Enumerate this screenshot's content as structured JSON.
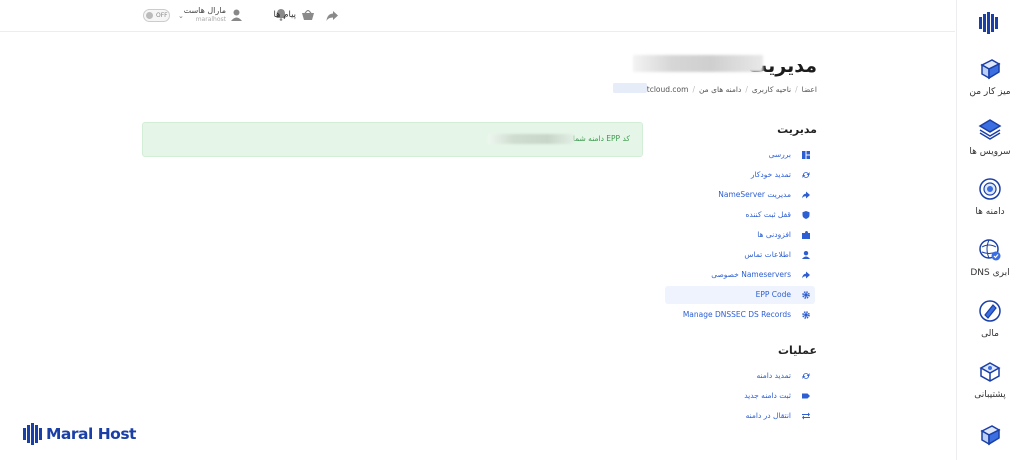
{
  "sidebar": {
    "items": [
      {
        "label": "میز کار من",
        "icon": "desk-icon"
      },
      {
        "label": "سرویس ها",
        "icon": "layers-icon"
      },
      {
        "label": "دامنه ها",
        "icon": "globe-icon"
      },
      {
        "label": "DNS ابری",
        "icon": "cloud-dns-icon"
      },
      {
        "label": "مالی",
        "icon": "wallet-icon"
      },
      {
        "label": "پشتیبانی",
        "icon": "support-icon"
      },
      {
        "label": "",
        "icon": "extra-icon"
      }
    ]
  },
  "topbar": {
    "toggle_label": "OFF",
    "user_name": "مارال هاست",
    "user_sub": "maralhost",
    "messages_label": "پیام ها"
  },
  "page": {
    "title": "مدیریت",
    "breadcrumb": [
      "اعضا",
      "ناحیه کاربری",
      "دامنه های من",
      "imextcloud.com"
    ]
  },
  "manage_section": {
    "title": "مدیریت",
    "items": [
      {
        "label": "بررسی",
        "icon": "dashboard-icon"
      },
      {
        "label": "تمدید خودکار",
        "icon": "refresh-icon"
      },
      {
        "label": "مدیریت NameServer",
        "icon": "arrow-icon"
      },
      {
        "label": "قفل ثبت کننده",
        "icon": "shield-icon"
      },
      {
        "label": "افزودنی ها",
        "icon": "puzzle-icon"
      },
      {
        "label": "اطلاعات تماس",
        "icon": "user-icon"
      },
      {
        "label": "Nameservers خصوصی",
        "icon": "arrow-icon"
      },
      {
        "label": "EPP Code",
        "icon": "gear-icon",
        "active": true
      },
      {
        "label": "Manage DNSSEC DS Records",
        "icon": "gear-icon"
      }
    ]
  },
  "ops_section": {
    "title": "عملیات",
    "items": [
      {
        "label": "تمدید دامنه",
        "icon": "refresh-icon"
      },
      {
        "label": "ثبت دامنه جدید",
        "icon": "tag-icon"
      },
      {
        "label": "انتقال در دامنه",
        "icon": "transfer-icon"
      }
    ]
  },
  "alert": {
    "text": "کد EPP دامنه شما"
  },
  "brand": {
    "text": "Maral Host"
  },
  "colors": {
    "accent": "#2d5fd3",
    "brand": "#1a3fa7",
    "success_bg": "#e5f6e8",
    "success_text": "#3e9b4f"
  }
}
